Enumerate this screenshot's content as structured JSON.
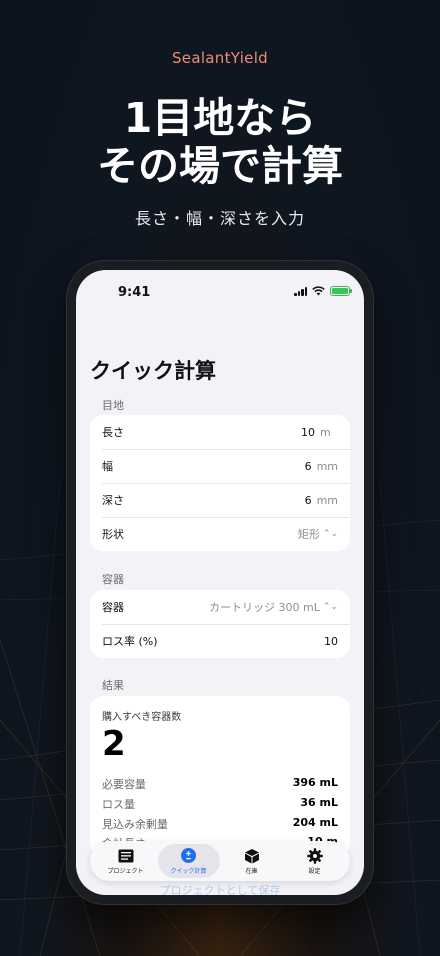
{
  "brand": "SealantYield",
  "headline": {
    "line1": "1目地なら",
    "line2": "その場で計算"
  },
  "subhead": "長さ・幅・深さを入力",
  "status_bar": {
    "time": "9:41"
  },
  "screen": {
    "title": "クイック計算",
    "joint": {
      "section": "目地",
      "rows": [
        {
          "label": "長さ",
          "value": "10",
          "unit": "m"
        },
        {
          "label": "幅",
          "value": "6",
          "unit": "mm"
        },
        {
          "label": "深さ",
          "value": "6",
          "unit": "mm"
        }
      ],
      "shape": {
        "label": "形状",
        "value": "矩形"
      }
    },
    "container": {
      "section": "容器",
      "type": {
        "label": "容器",
        "value": "カートリッジ 300 mL"
      },
      "loss": {
        "label": "ロス率 (%)",
        "value": "10"
      }
    },
    "results": {
      "section": "結果",
      "title": "購入すべき容器数",
      "count": "2",
      "rows": [
        {
          "label": "必要容量",
          "value": "396 mL"
        },
        {
          "label": "ロス量",
          "value": "36 mL"
        },
        {
          "label": "見込み余剰量",
          "value": "204 mL"
        },
        {
          "label": "合計長さ",
          "value": "10 m"
        }
      ]
    },
    "save_link": "プロジェクトとして保存",
    "tabbar": {
      "tabs": [
        {
          "label": "プロジェクト",
          "icon": "list-icon"
        },
        {
          "label": "クイック計算",
          "icon": "plus-minus-icon",
          "active": true
        },
        {
          "label": "在庫",
          "icon": "box-icon"
        },
        {
          "label": "設定",
          "icon": "gear-icon"
        }
      ]
    }
  },
  "colors": {
    "accent": "#1f6feb",
    "brand": "#f08a7a",
    "background": "#0b131c"
  }
}
